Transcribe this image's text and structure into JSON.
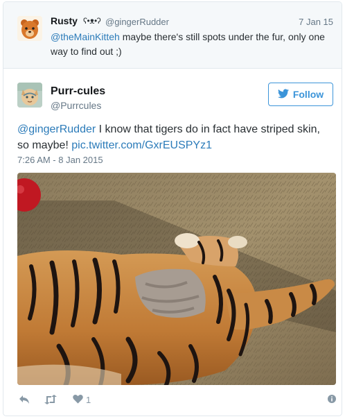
{
  "parent_tweet": {
    "author_name": "Rusty",
    "badge": "ʕ•ᴥ•ʔ",
    "handle": "@gingerRudder",
    "date": "7 Jan 15",
    "mention": "@theMainKitteh",
    "text_line1_rest": " maybe there's still spots under the fur, only one",
    "text_line2": "way to find out ;)"
  },
  "tweet": {
    "author_name": "Purr-cules",
    "handle": "@Purrcules",
    "follow_label": "Follow",
    "mention": "@gingerRudder",
    "text_line1_rest": " I know that tigers do in fact have striped skin,",
    "text_line2_before_link": "so maybe! ",
    "link": "pic.twitter.com/GxrEUSPYz1",
    "timestamp": "7:26 AM - 8 Jan 2015",
    "like_count": "1"
  },
  "icons": {
    "follow": "bird-icon",
    "reply": "reply-icon",
    "retweet": "retweet-icon",
    "like": "heart-icon",
    "info": "info-icon"
  },
  "colors": {
    "accent": "#3b94d9",
    "link": "#2b7bb9",
    "muted": "#657786",
    "action_gray": "#8899a6"
  }
}
